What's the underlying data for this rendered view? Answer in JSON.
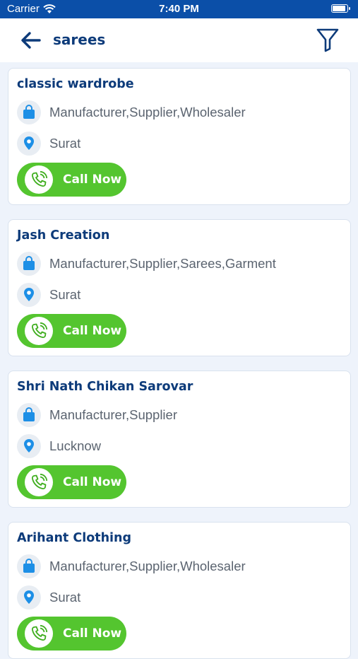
{
  "status_bar": {
    "carrier": "Carrier",
    "time": "7:40 PM"
  },
  "nav": {
    "title": "sarees"
  },
  "colors": {
    "primary": "#0b4fa8",
    "title": "#0d3b7a",
    "call_green": "#54c52f",
    "icon_blue": "#1d8fe6"
  },
  "icons": {
    "back": "arrow-left-icon",
    "filter": "filter-icon",
    "category": "bag-icon",
    "location": "location-pin-icon",
    "call": "phone-call-icon"
  },
  "listings": [
    {
      "name": "classic wardrobe",
      "categories": "Manufacturer,Supplier,Wholesaler",
      "city": "Surat",
      "call_label": "Call Now"
    },
    {
      "name": "Jash Creation",
      "categories": "Manufacturer,Supplier,Sarees,Garment",
      "city": "Surat",
      "call_label": "Call Now"
    },
    {
      "name": "Shri Nath Chikan Sarovar",
      "categories": "Manufacturer,Supplier",
      "city": "Lucknow",
      "call_label": "Call Now"
    },
    {
      "name": "Arihant Clothing",
      "categories": "Manufacturer,Supplier,Wholesaler",
      "city": "Surat",
      "call_label": "Call Now"
    }
  ]
}
